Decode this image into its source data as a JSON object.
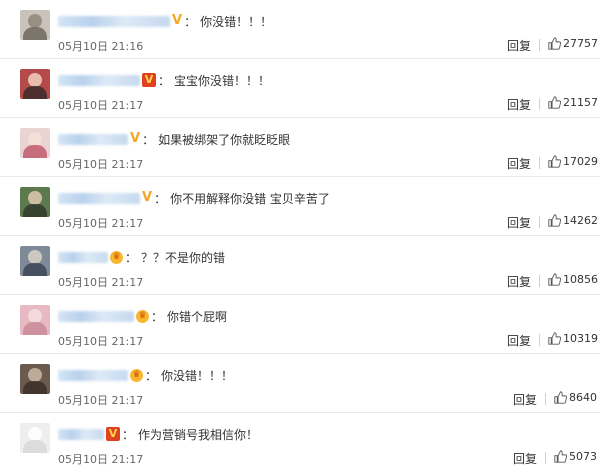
{
  "comments": [
    {
      "text": "你没错！！！",
      "time": "05月10日 21:16",
      "reply": "回复",
      "likes": "27757",
      "badge": "v-yellow",
      "avatar_colors": [
        "#c9c3bb",
        "#8e8779",
        "#6e675e"
      ]
    },
    {
      "text": "宝宝你没错！！！",
      "time": "05月10日 21:17",
      "reply": "回复",
      "likes": "21157",
      "badge": "v-red",
      "avatar_colors": [
        "#b44a4a",
        "#f0d0c0",
        "#3b2a2a"
      ]
    },
    {
      "text": "如果被绑架了你就眨眨眼",
      "time": "05月10日 21:17",
      "reply": "回复",
      "likes": "17029",
      "badge": "v-yellow",
      "avatar_colors": [
        "#e9d3d3",
        "#f5e0d8",
        "#c25b6b"
      ]
    },
    {
      "text": "你不用解释你没错 宝贝辛苦了",
      "time": "05月10日 21:17",
      "reply": "回复",
      "likes": "14262",
      "badge": "v-yellow",
      "avatar_colors": [
        "#5c7a4e",
        "#e3c9b3",
        "#2f3b2a"
      ]
    },
    {
      "text": "？？不是你的错",
      "time": "05月10日 21:17",
      "reply": "回复",
      "likes": "10856",
      "badge": "crown",
      "avatar_colors": [
        "#7f8a99",
        "#d8d1c8",
        "#3c4554"
      ]
    },
    {
      "text": "你错个屁啊",
      "time": "05月10日 21:17",
      "reply": "回复",
      "likes": "10319",
      "badge": "crown",
      "avatar_colors": [
        "#e7b9c2",
        "#f6dde0",
        "#c98a98"
      ]
    },
    {
      "text": "你没错！！！",
      "time": "05月10日 21:17",
      "reply": "回复",
      "likes": "8640",
      "badge": "crown",
      "avatar_colors": [
        "#6b5b4f",
        "#cdb9a5",
        "#3a2f28"
      ]
    },
    {
      "text": "作为营销号我相信你！",
      "time": "05月10日 21:17",
      "reply": "回复",
      "likes": "5073",
      "badge": "v-red",
      "avatar_colors": [
        "#eeeeee",
        "#ffffff",
        "#d8d8d8"
      ]
    }
  ],
  "colors": {
    "accent_v": "#f5a623",
    "v_red": "#e0411e",
    "divider": "#e9e9e9"
  },
  "icons": {
    "like": "thumbs-up-icon",
    "verified": "verified-v-icon",
    "crown": "crown-badge-icon"
  }
}
